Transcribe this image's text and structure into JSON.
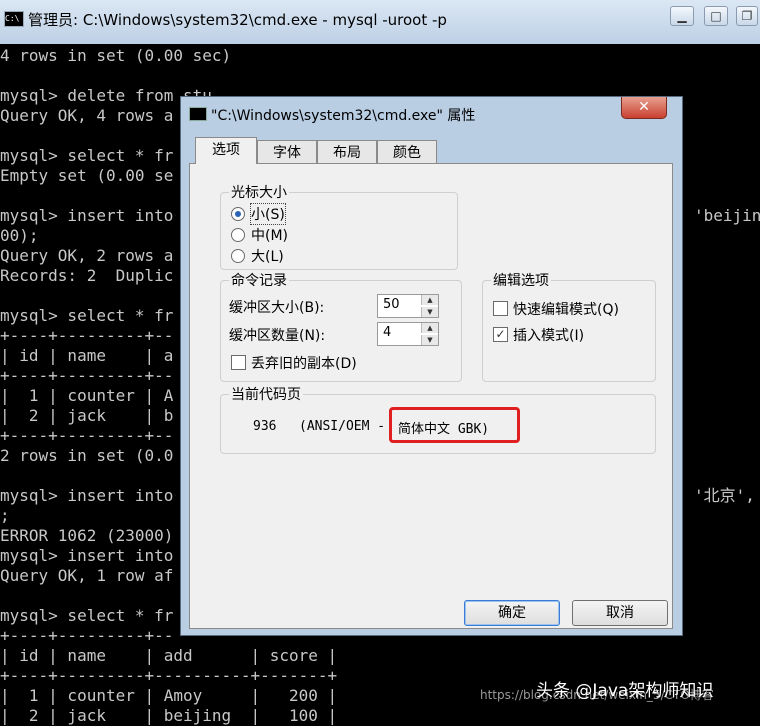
{
  "window": {
    "title": "管理员: C:\\Windows\\system32\\cmd.exe - mysql  -uroot -p",
    "icon": "cmd-icon"
  },
  "console": {
    "lines": [
      "4 rows in set (0.00 sec)",
      "",
      "mysql> delete from stu",
      "Query OK, 4 rows a",
      "",
      "mysql> select * fr",
      "Empty set (0.00 se",
      "",
      "mysql> insert into",
      "00);",
      "Query OK, 2 rows a",
      "Records: 2  Duplic",
      "",
      "mysql> select * fr",
      "+----+---------+--",
      "| id | name    | a",
      "+----+---------+--",
      "|  1 | counter | A",
      "|  2 | jack    | b",
      "+----+---------+--",
      "2 rows in set (0.0",
      "",
      "mysql> insert into",
      ";",
      "ERROR 1062 (23000)",
      "mysql> insert into",
      "Query OK, 1 row af",
      "",
      "mysql> select * fr",
      "+----+---------+--",
      "| id | name    | add      | score |",
      "+----+---------+----------+-------+",
      "|  1 | counter | Amoy     |   200 |",
      "|  2 | jack    | beijing  |   100 |"
    ],
    "right_fragments": {
      "beijing": "'beijin",
      "beijing_ext": "'beijing'",
      "beijing2": "'北京',"
    }
  },
  "dialog": {
    "title": "\"C:\\Windows\\system32\\cmd.exe\" 属性",
    "close_label": "✕",
    "tabs": [
      "选项",
      "字体",
      "布局",
      "颜色"
    ],
    "cursor_group": {
      "title": "光标大小",
      "options": [
        "小(S)",
        "中(M)",
        "大(L)"
      ],
      "selected": 0
    },
    "history_group": {
      "title": "命令记录",
      "buffer_size_label": "缓冲区大小(B):",
      "buffer_size_value": "50",
      "buffer_count_label": "缓冲区数量(N):",
      "buffer_count_value": "4",
      "discard_label": "丢弃旧的副本(D)",
      "discard_checked": false
    },
    "edit_group": {
      "title": "编辑选项",
      "quickedit_label": "快速编辑模式(Q)",
      "quickedit_checked": false,
      "insert_label": "插入模式(I)",
      "insert_checked": true
    },
    "codepage_group": {
      "title": "当前代码页",
      "code": "936",
      "desc": "(ANSI/OEM -",
      "highlight": "简体中文 GBK)"
    },
    "ok_label": "确定",
    "cancel_label": "取消"
  },
  "watermark": {
    "text": "头条 @Java架构师知识",
    "url": "https://blog.csdn.net/weixin_5/CTO博客"
  },
  "colors": {
    "highlight_box": "#e02020",
    "console_text": "#c8c8c8"
  }
}
